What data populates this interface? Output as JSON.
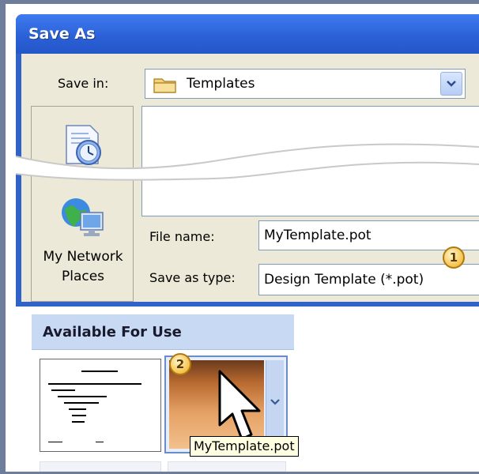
{
  "dialog": {
    "title": "Save As",
    "save_in_label": "Save in:",
    "save_in_value": "Templates",
    "places": [
      {
        "icon": "history-icon",
        "label": ""
      },
      {
        "icon": "network-places-icon",
        "label": "My Network Places"
      }
    ],
    "file_name_label": "File name:",
    "file_name_value": "MyTemplate.pot",
    "save_as_type_label": "Save as type:",
    "save_as_type_value": "Design Template (*.pot)"
  },
  "callouts": {
    "one": "1",
    "two": "2"
  },
  "panel": {
    "title": "Available For Use",
    "thumbnails": [
      {
        "name": "default-design",
        "selected": false
      },
      {
        "name": "MyTemplate.pot",
        "selected": true
      }
    ],
    "tooltip": "MyTemplate.pot"
  },
  "colors": {
    "title_bar": "#2a5fd6",
    "dialog_body": "#ece9d8",
    "panel_header": "#c8daf3",
    "tooltip_bg": "#ffffe1",
    "callout": "#f5c24a"
  }
}
